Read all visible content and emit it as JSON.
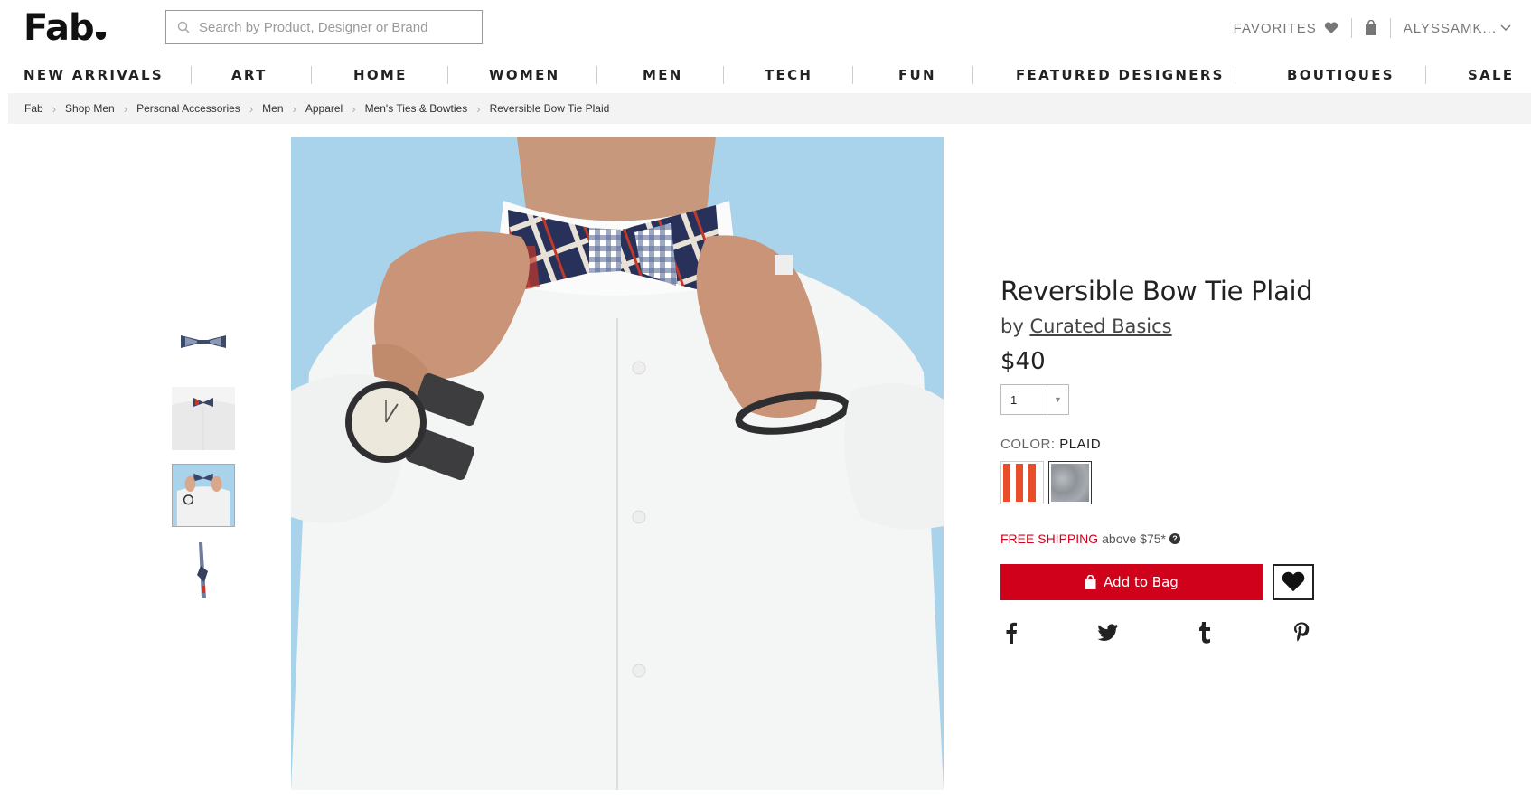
{
  "header": {
    "logo": "Fab",
    "search_placeholder": "Search by Product, Designer or Brand",
    "favorites_label": "FAVORITES",
    "user_label": "ALYSSAMK..."
  },
  "nav": {
    "items": [
      "NEW ARRIVALS",
      "ART",
      "HOME",
      "WOMEN",
      "MEN",
      "TECH",
      "FUN",
      "FEATURED DESIGNERS",
      "BOUTIQUES",
      "SALE"
    ]
  },
  "breadcrumb": [
    "Fab",
    "Shop Men",
    "Personal Accessories",
    "Men",
    "Apparel",
    "Men's Ties & Bowties",
    "Reversible Bow Tie Plaid"
  ],
  "product": {
    "title": "Reversible Bow Tie Plaid",
    "by_prefix": "by",
    "designer": "Curated Basics",
    "price": "$40",
    "quantity": "1",
    "color_label": "COLOR:",
    "color_value": "PLAID",
    "swatches": [
      "orange-stripe",
      "plaid"
    ],
    "shipping_free": "FREE SHIPPING",
    "shipping_rest": "above $75*",
    "add_to_bag": "Add to Bag"
  },
  "icons": {
    "search": "search-icon",
    "heart": "heart-icon",
    "bag": "shopping-bag-icon",
    "chevron": "chevron-down-icon",
    "social": [
      "facebook-icon",
      "twitter-icon",
      "tumblr-icon",
      "pinterest-icon"
    ]
  },
  "colors": {
    "accent": "#d0021b",
    "background_image": "#a9d3ea"
  }
}
